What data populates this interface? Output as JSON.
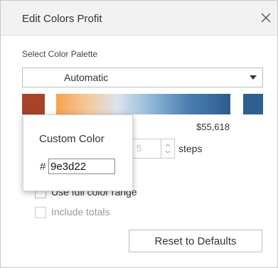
{
  "dialog": {
    "title": "Edit Colors Profit",
    "close_icon": "close-icon"
  },
  "palette": {
    "label": "Select Color Palette",
    "selected": "Automatic",
    "dropdown_icon": "caret-down-icon"
  },
  "ramp": {
    "start_color": "#a8432a",
    "end_color": "#2f5f8f",
    "max_value": "$55,618"
  },
  "stepped": {
    "steps_value": "5",
    "steps_label": "steps"
  },
  "options": {
    "full_range_label": "Use full color range",
    "include_totals_label": "Include totals"
  },
  "custom_color": {
    "title": "Custom Color",
    "hash": "#",
    "hex_value": "9e3d22"
  },
  "buttons": {
    "reset_label": "Reset to Defaults"
  }
}
